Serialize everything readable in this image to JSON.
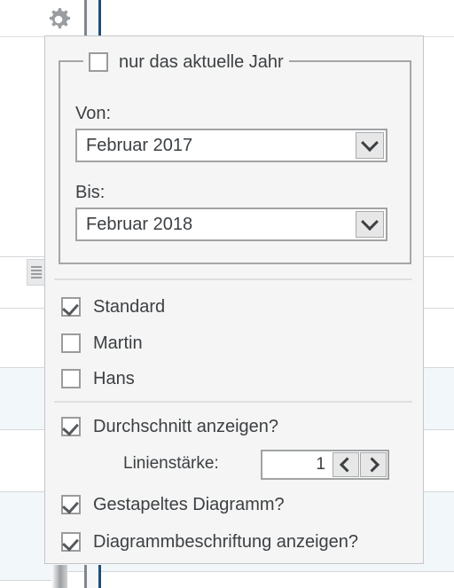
{
  "window": {
    "popup_title": "",
    "gear_icon": "gear-icon"
  },
  "background": {
    "grid_icon": "list-lines-icon",
    "row_fill_plain": "#ffffff",
    "row_fill_alt": "#f2f7f9",
    "row_line_color": "#d4d7da",
    "divider_gray": "#7f868c",
    "divider_blue": "#1f4e79"
  },
  "panel": {
    "background_color": "#f5f5f5",
    "border_color": "#c4c6c8",
    "group": {
      "title": "nur das aktuelle Jahr",
      "title_checked": false,
      "fields": [
        {
          "label": "Von:",
          "value": "Februar 2017",
          "dropdown_icon": "chevron-down-icon"
        },
        {
          "label": "Bis:",
          "value": "Februar 2018",
          "dropdown_icon": "chevron-down-icon"
        }
      ]
    },
    "series_checkboxes": [
      {
        "label": "Standard",
        "checked": true
      },
      {
        "label": "Martin",
        "checked": false
      },
      {
        "label": "Hans",
        "checked": false
      }
    ],
    "average": {
      "label": "Durchschnitt anzeigen?",
      "checked": true,
      "line_width_label": "Linienstärke:",
      "line_width_value": "1",
      "decrement_icon": "chevron-left-icon",
      "increment_icon": "chevron-right-icon"
    },
    "options": [
      {
        "label": "Gestapeltes Diagramm?",
        "checked": true
      },
      {
        "label": "Diagrammbeschriftung anzeigen?",
        "checked": true
      }
    ]
  }
}
